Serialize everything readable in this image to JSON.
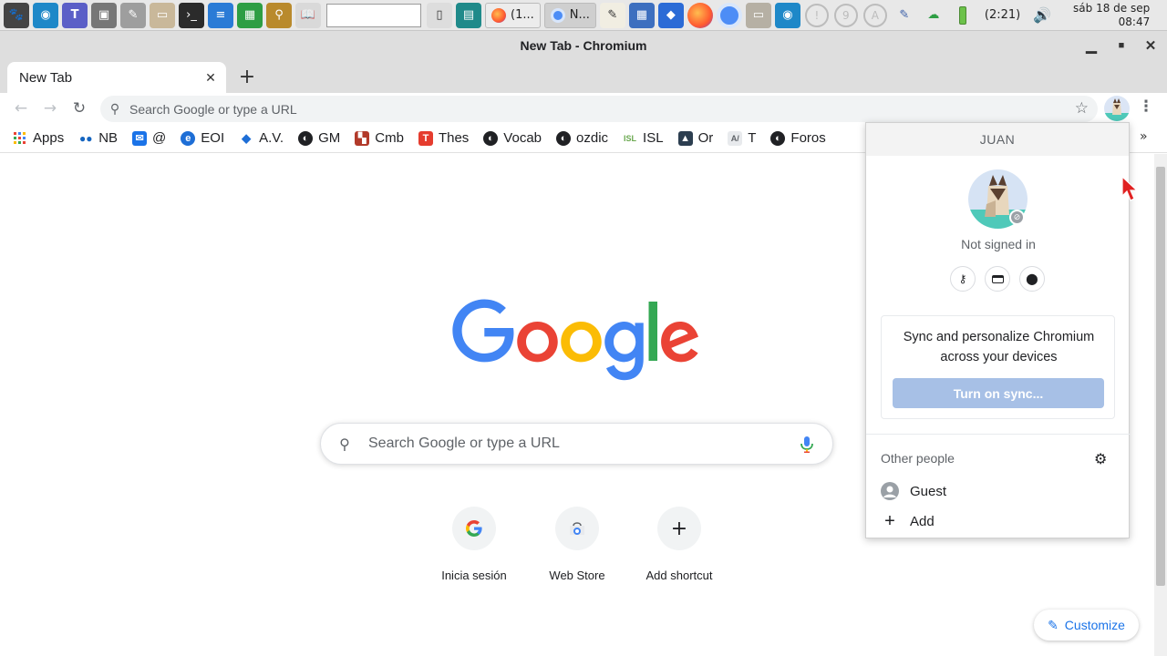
{
  "taskbar": {
    "tasks": [
      {
        "label": "(1...",
        "icon": "firefox-icon"
      },
      {
        "label": "N...",
        "icon": "chromium-icon"
      }
    ],
    "indicators": [
      "!",
      "9",
      "A"
    ],
    "battery_time": "(2:21)",
    "clock_date": "sáb 18 de sep",
    "clock_time": "08:47"
  },
  "window": {
    "title": "New Tab - Chromium"
  },
  "tabs": [
    {
      "label": "New Tab"
    }
  ],
  "omnibox": {
    "placeholder": "Search Google or type a URL"
  },
  "bookmarks": [
    {
      "label": "Apps",
      "icon": "apps-grid-icon"
    },
    {
      "label": "NB",
      "icon": "nb-icon"
    },
    {
      "label": "@",
      "icon": "mail-icon"
    },
    {
      "label": "EOI",
      "icon": "eoi-icon"
    },
    {
      "label": "A.V.",
      "icon": "graduation-cap-icon"
    },
    {
      "label": "GM",
      "icon": "globe-icon"
    },
    {
      "label": "Cmb",
      "icon": "crest-icon"
    },
    {
      "label": "Thes",
      "icon": "thesaurus-icon"
    },
    {
      "label": "Vocab",
      "icon": "globe-icon"
    },
    {
      "label": "ozdic",
      "icon": "globe-icon"
    },
    {
      "label": "ISL",
      "icon": "isl-icon"
    },
    {
      "label": "Or",
      "icon": "tower-icon"
    },
    {
      "label": "T",
      "icon": "translate-icon"
    },
    {
      "label": "Foros",
      "icon": "globe-icon"
    }
  ],
  "ntp": {
    "search_placeholder": "Search Google or type a URL",
    "shortcuts": [
      {
        "label": "Inicia sesión",
        "icon": "google-icon"
      },
      {
        "label": "Web Store",
        "icon": "web-store-icon"
      },
      {
        "label": "Add shortcut",
        "icon": "plus-icon"
      }
    ],
    "customize_label": "Customize"
  },
  "profile_menu": {
    "name": "JUAN",
    "status": "Not signed in",
    "sync_text": "Sync and personalize Chromium across your devices",
    "sync_button": "Turn on sync...",
    "other_people_label": "Other people",
    "people": [
      {
        "label": "Guest",
        "icon": "guest-icon"
      },
      {
        "label": "Add",
        "icon": "plus-icon"
      }
    ]
  },
  "colors": {
    "accent": "#1a73e8",
    "sync_button_bg": "#a7c0e6"
  }
}
